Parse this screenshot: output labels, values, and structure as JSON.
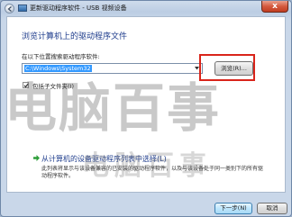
{
  "window": {
    "title": "更新驱动程序软件 - USB 视频设备",
    "close_label": "x"
  },
  "content": {
    "heading": "浏览计算机上的驱动程序文件",
    "path_label": "在以下位置搜索驱动程序软件:",
    "path_value": "C:\\Windows\\System32",
    "browse_label": "浏览(R)...",
    "include_subfolders_label": "包括子文件夹(I)",
    "include_subfolders_checked": true,
    "pick_title": "从计算机的设备驱动程序列表中选择(L)",
    "pick_description": "此列表将显示与该设备兼容的已安装的驱动程序软件，以及与该设备处于同一类别下的所有驱动程序软件。"
  },
  "footer": {
    "next_label": "下一步(N)",
    "cancel_label": "取消"
  },
  "watermark": {
    "text": "电脑百事",
    "sub_text": "电脑百事"
  },
  "colors": {
    "heading": "#1e3c8c",
    "highlight": "#d9251b",
    "selection": "#3399ff"
  }
}
